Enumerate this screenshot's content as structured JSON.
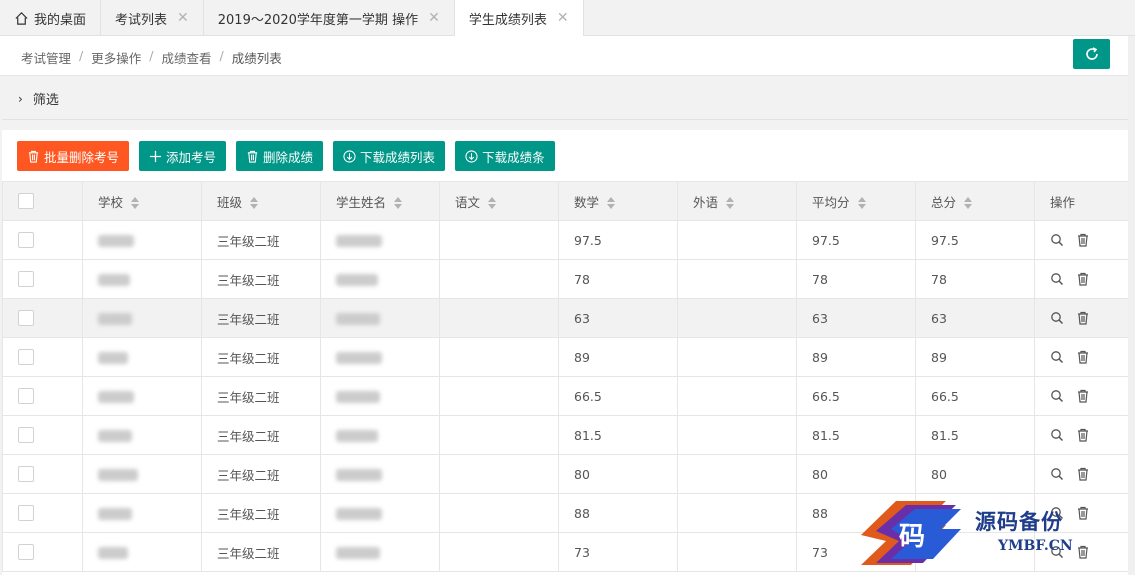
{
  "tabs": [
    {
      "label": "我的桌面",
      "icon": "home-icon",
      "closable": false,
      "active": false
    },
    {
      "label": "考试列表",
      "closable": true,
      "active": false
    },
    {
      "label": "2019～2020学年度第一学期 操作",
      "closable": true,
      "active": false
    },
    {
      "label": "学生成绩列表",
      "closable": true,
      "active": true
    }
  ],
  "close_glyph": "✕",
  "breadcrumb": [
    "考试管理",
    "更多操作",
    "成绩查看",
    "成绩列表"
  ],
  "breadcrumb_sep": "/",
  "filter": {
    "label": "筛选",
    "chevron": "›"
  },
  "toolbar": {
    "batch_delete": "批量删除考号",
    "add": "添加考号",
    "delete_scores": "删除成绩",
    "download_list": "下载成绩列表",
    "download_slip": "下载成绩条"
  },
  "colors": {
    "primary": "#009688",
    "danger": "#ff5722"
  },
  "table": {
    "headers": [
      "学校",
      "班级",
      "学生姓名",
      "语文",
      "数学",
      "外语",
      "平均分",
      "总分",
      "操作"
    ],
    "rows": [
      {
        "class": "三年级二班",
        "chinese": "",
        "math": "97.5",
        "foreign": "",
        "avg": "97.5",
        "total": "97.5"
      },
      {
        "class": "三年级二班",
        "chinese": "",
        "math": "78",
        "foreign": "",
        "avg": "78",
        "total": "78"
      },
      {
        "class": "三年级二班",
        "chinese": "",
        "math": "63",
        "foreign": "",
        "avg": "63",
        "total": "63"
      },
      {
        "class": "三年级二班",
        "chinese": "",
        "math": "89",
        "foreign": "",
        "avg": "89",
        "total": "89"
      },
      {
        "class": "三年级二班",
        "chinese": "",
        "math": "66.5",
        "foreign": "",
        "avg": "66.5",
        "total": "66.5"
      },
      {
        "class": "三年级二班",
        "chinese": "",
        "math": "81.5",
        "foreign": "",
        "avg": "81.5",
        "total": "81.5"
      },
      {
        "class": "三年级二班",
        "chinese": "",
        "math": "80",
        "foreign": "",
        "avg": "80",
        "total": "80"
      },
      {
        "class": "三年级二班",
        "chinese": "",
        "math": "88",
        "foreign": "",
        "avg": "88",
        "total": ""
      },
      {
        "class": "三年级二班",
        "chinese": "",
        "math": "73",
        "foreign": "",
        "avg": "73",
        "total": ""
      }
    ],
    "highlight_row": 2
  },
  "watermark": {
    "text": "源码备份",
    "sub": "YMBF.CN",
    "glyph": "码"
  }
}
